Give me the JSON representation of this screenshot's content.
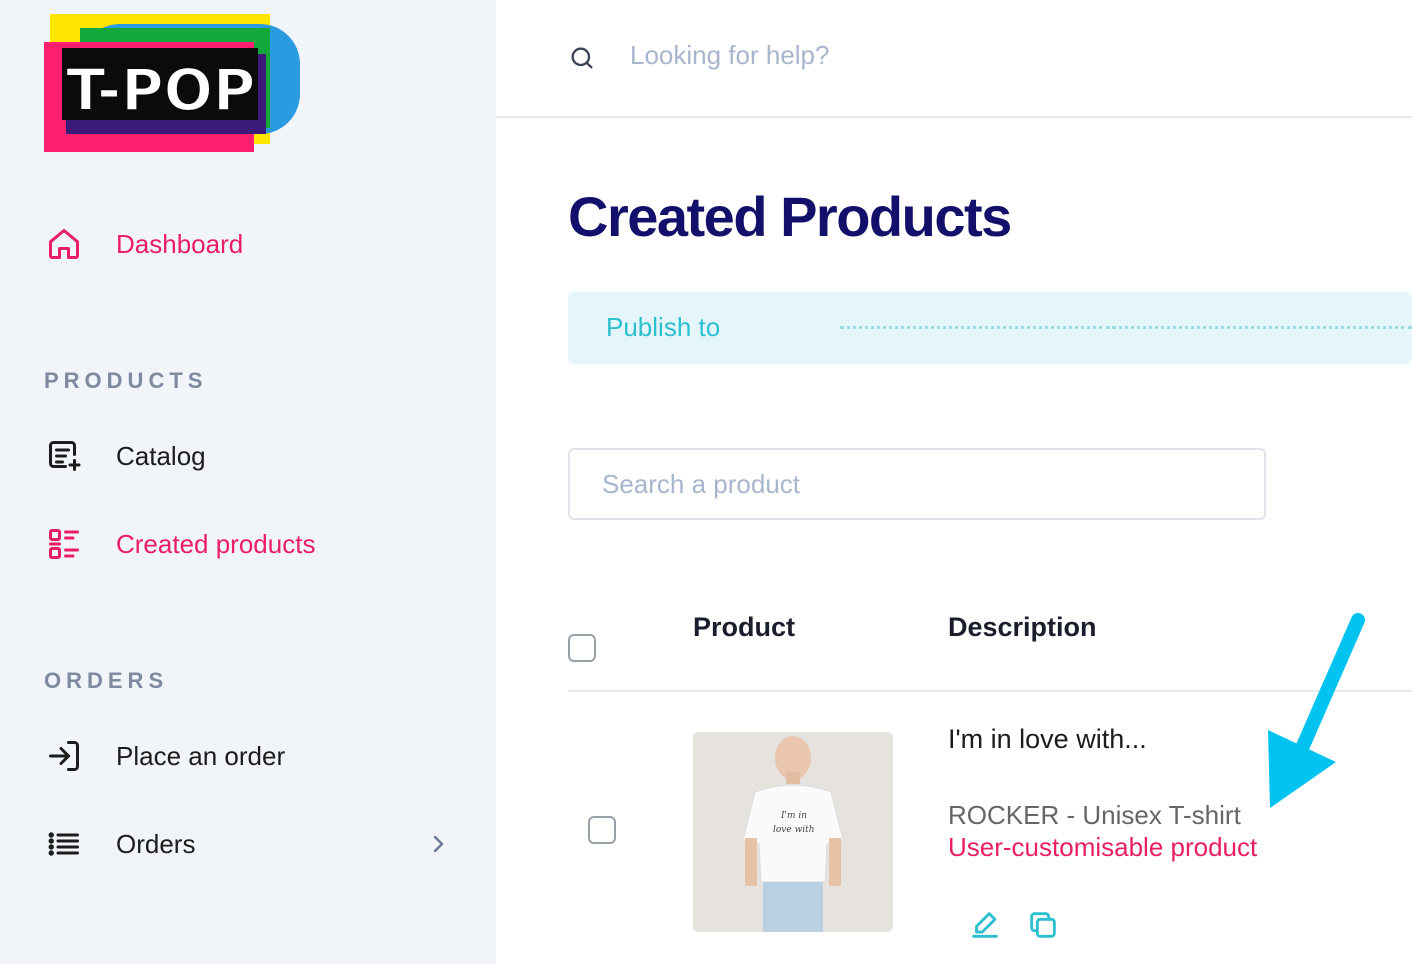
{
  "logo": {
    "text": "T-POP"
  },
  "sidebar": {
    "dashboard": {
      "label": "Dashboard",
      "icon": "home-icon"
    },
    "products_section": "PRODUCTS",
    "catalog": {
      "label": "Catalog",
      "icon": "catalog-icon"
    },
    "created_products": {
      "label": "Created products",
      "icon": "list-icon"
    },
    "orders_section": "ORDERS",
    "place_order": {
      "label": "Place an order",
      "icon": "login-arrow-icon"
    },
    "orders": {
      "label": "Orders",
      "icon": "list-lines-icon"
    }
  },
  "header": {
    "search_placeholder": "Looking for help?"
  },
  "main": {
    "title": "Created Products",
    "banner": {
      "text": "Publish to"
    },
    "product_search_placeholder": "Search a product",
    "table": {
      "columns": [
        "Product",
        "Description"
      ],
      "rows": [
        {
          "name": "I'm in love with...",
          "subtitle": "ROCKER - Unisex T-shirt",
          "tag": "User-customisable product",
          "shirt_text": [
            "I'm in",
            "love with"
          ]
        }
      ]
    }
  },
  "colors": {
    "accent": "#e91e63",
    "title": "#12106a",
    "teal": "#2bbfd0",
    "sidebar_bg": "#f1f4f9",
    "annotation_arrow": "#00c3f2"
  }
}
